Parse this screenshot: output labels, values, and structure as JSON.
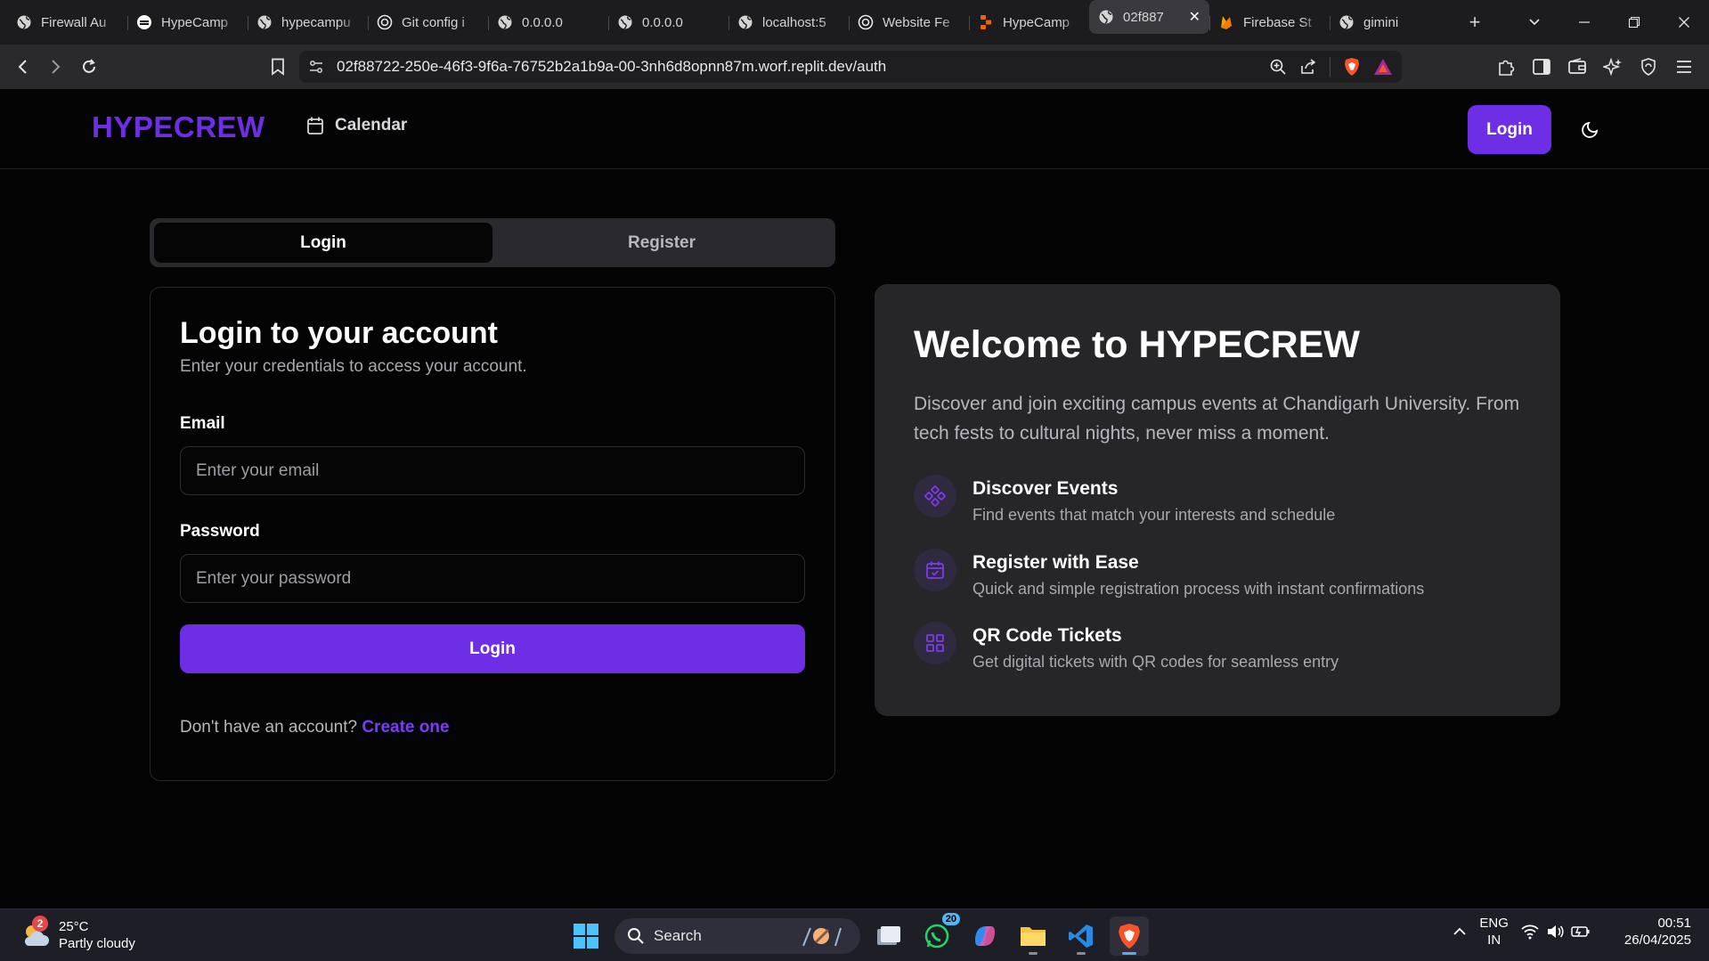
{
  "browser": {
    "tabs": [
      {
        "title": "Firewall Au",
        "icon": "globe-icon"
      },
      {
        "title": "HypeCamp",
        "icon": "app-icon"
      },
      {
        "title": "hypecampu",
        "icon": "globe-icon"
      },
      {
        "title": "Git config i",
        "icon": "chatgpt-icon"
      },
      {
        "title": "0.0.0.0",
        "icon": "globe-icon"
      },
      {
        "title": "0.0.0.0",
        "icon": "globe-icon"
      },
      {
        "title": "localhost:5",
        "icon": "globe-icon"
      },
      {
        "title": "Website Fe",
        "icon": "chatgpt-icon"
      },
      {
        "title": "HypeCamp",
        "icon": "replit-icon"
      },
      {
        "title": "02f887",
        "icon": "globe-icon",
        "active": true
      },
      {
        "title": "Firebase St",
        "icon": "firebase-icon"
      },
      {
        "title": "gimini",
        "icon": "globe-icon"
      }
    ],
    "url": "02f88722-250e-46f3-9f6a-76752b2a1b9a-00-3nh6d8opnn87m.worf.replit.dev/auth"
  },
  "header": {
    "logo": "HYPECREW",
    "nav_calendar": "Calendar",
    "login_button": "Login"
  },
  "auth_tabs": {
    "login": "Login",
    "register": "Register"
  },
  "login_form": {
    "title": "Login to your account",
    "subtitle": "Enter your credentials to access your account.",
    "email_label": "Email",
    "email_placeholder": "Enter your email",
    "email_value": "",
    "password_label": "Password",
    "password_placeholder": "Enter your password",
    "password_value": "",
    "submit": "Login",
    "signup_prompt": "Don't have an account?",
    "signup_link": "Create one"
  },
  "welcome": {
    "title": "Welcome to HYPECREW",
    "description": "Discover and join exciting campus events at Chandigarh University. From tech fests to cultural nights, never miss a moment.",
    "features": [
      {
        "title": "Discover Events",
        "desc": "Find events that match your interests and schedule",
        "icon": "sparkle-icon"
      },
      {
        "title": "Register with Ease",
        "desc": "Quick and simple registration process with instant confirmations",
        "icon": "calendar-check-icon"
      },
      {
        "title": "QR Code Tickets",
        "desc": "Get digital tickets with QR codes for seamless entry",
        "icon": "grid-icon"
      }
    ]
  },
  "taskbar": {
    "weather_temp": "25°C",
    "weather_desc": "Partly cloudy",
    "weather_badge": "2",
    "search": "Search",
    "whatsapp_badge": "20",
    "lang_top": "ENG",
    "lang_bottom": "IN",
    "time": "00:51",
    "date": "26/04/2025"
  },
  "colors": {
    "accent": "#6d2ee6",
    "background": "#040405",
    "card": "#262629"
  }
}
